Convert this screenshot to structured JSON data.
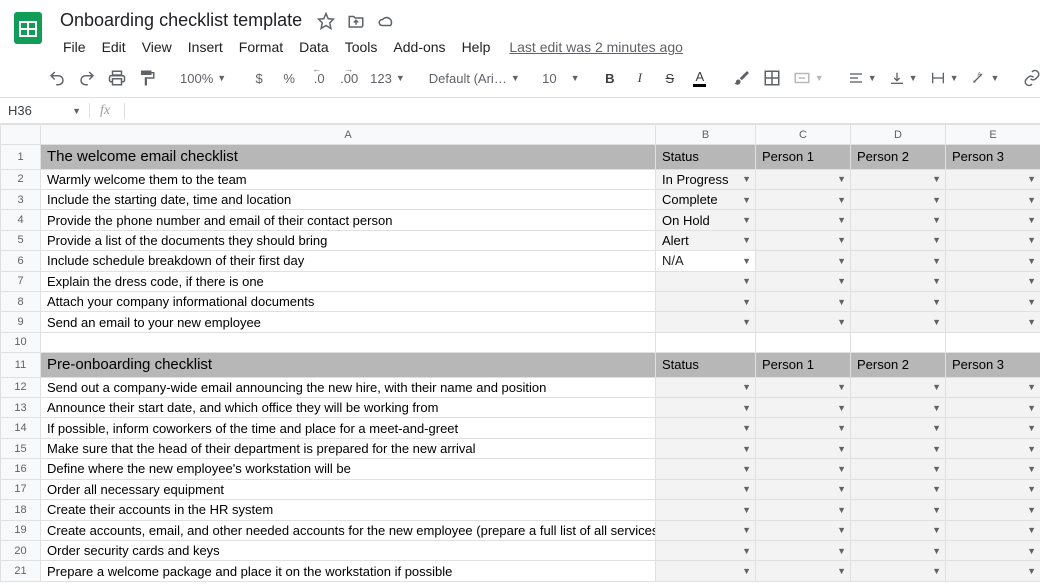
{
  "header": {
    "doc_title": "Onboarding checklist template",
    "last_edit": "Last edit was 2 minutes ago"
  },
  "menubar": {
    "items": [
      "File",
      "Edit",
      "View",
      "Insert",
      "Format",
      "Data",
      "Tools",
      "Add-ons",
      "Help"
    ]
  },
  "toolbar": {
    "zoom": "100%",
    "currency": "$",
    "percent": "%",
    "dec_dec": ".0",
    "inc_dec": ".00",
    "more_formats": "123",
    "font": "Default (Ari…",
    "font_size": "10",
    "bold": "B",
    "italic": "I",
    "strike": "S",
    "text_color_letter": "A"
  },
  "namebox": {
    "ref": "H36"
  },
  "columns": [
    "A",
    "B",
    "C",
    "D",
    "E"
  ],
  "rows": [
    {
      "n": 1,
      "type": "section",
      "a": "The welcome email checklist",
      "b": "Status",
      "c": "Person 1",
      "d": "Person 2",
      "e": "Person 3"
    },
    {
      "n": 2,
      "type": "item",
      "a": "Warmly welcome them to the team",
      "b": "In Progress",
      "b_class": "st-inprogress"
    },
    {
      "n": 3,
      "type": "item",
      "a": "Include the starting date, time and location",
      "b": "Complete",
      "b_class": "st-complete"
    },
    {
      "n": 4,
      "type": "item",
      "a": "Provide the phone number and email of their contact person",
      "b": "On Hold",
      "b_class": "st-onhold"
    },
    {
      "n": 5,
      "type": "item",
      "a": "Provide a list of the documents they should bring",
      "b": "Alert",
      "b_class": "st-alert"
    },
    {
      "n": 6,
      "type": "item",
      "a": "Include schedule breakdown of their first day",
      "b": "N/A",
      "b_class": ""
    },
    {
      "n": 7,
      "type": "item",
      "a": "Explain the dress code, if there is one"
    },
    {
      "n": 8,
      "type": "item",
      "a": "Attach your company informational documents"
    },
    {
      "n": 9,
      "type": "item",
      "a": "Send an email to your new employee"
    },
    {
      "n": 10,
      "type": "blank"
    },
    {
      "n": 11,
      "type": "section",
      "a": "Pre-onboarding checklist",
      "b": "Status",
      "c": "Person 1",
      "d": "Person 2",
      "e": "Person 3"
    },
    {
      "n": 12,
      "type": "item",
      "a": "Send out a company-wide email announcing the new hire, with their name and position"
    },
    {
      "n": 13,
      "type": "item",
      "a": "Announce their start date, and which office they will be working from"
    },
    {
      "n": 14,
      "type": "item",
      "a": "If possible, inform coworkers of the time and place for a meet-and-greet"
    },
    {
      "n": 15,
      "type": "item",
      "a": "Make sure that the head of their department is prepared for the new arrival"
    },
    {
      "n": 16,
      "type": "item",
      "a": "Define where the new employee's workstation will be"
    },
    {
      "n": 17,
      "type": "item",
      "a": "Order all necessary equipment"
    },
    {
      "n": 18,
      "type": "item",
      "a": "Create their accounts in the HR system"
    },
    {
      "n": 19,
      "type": "item",
      "a": "Create accounts, email, and other needed accounts for the new employee (prepare a full list of all services)"
    },
    {
      "n": 20,
      "type": "item",
      "a": "Order security cards and keys"
    },
    {
      "n": 21,
      "type": "item",
      "a": "Prepare a welcome package and place it on the workstation if possible"
    }
  ]
}
